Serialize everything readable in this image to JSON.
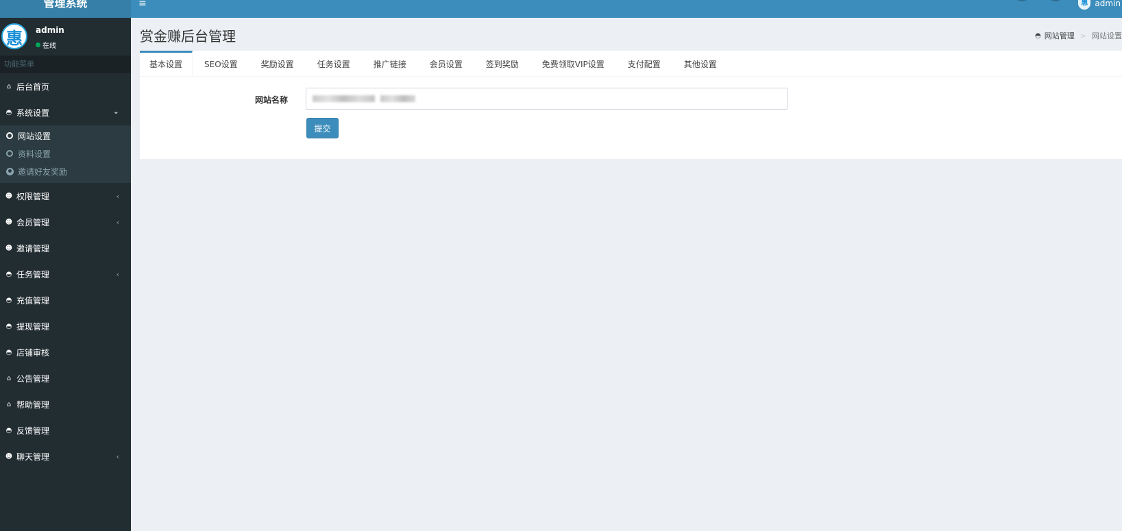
{
  "header": {
    "logo_text": "管理系统",
    "menu_toggle": "≡",
    "user_name": "admin",
    "avatar_char": "惠"
  },
  "sidebar": {
    "user": {
      "name": "admin",
      "status": "在线",
      "avatar_char": "惠"
    },
    "menu_header": "功能菜单",
    "items": [
      {
        "label": "后台首页",
        "icon": "home-icon"
      },
      {
        "label": "系统设置",
        "icon": "dashboard-icon",
        "expanded": true
      },
      {
        "label": "权限管理",
        "icon": "users-icon",
        "collapsible": true
      },
      {
        "label": "会员管理",
        "icon": "users-icon",
        "collapsible": true
      },
      {
        "label": "邀请管理",
        "icon": "users-icon"
      },
      {
        "label": "任务管理",
        "icon": "dashboard-icon",
        "collapsible": true
      },
      {
        "label": "充值管理",
        "icon": "dashboard-icon"
      },
      {
        "label": "提现管理",
        "icon": "dashboard-icon"
      },
      {
        "label": "店铺审核",
        "icon": "dashboard-icon"
      },
      {
        "label": "公告管理",
        "icon": "home-icon"
      },
      {
        "label": "帮助管理",
        "icon": "home-icon"
      },
      {
        "label": "反馈管理",
        "icon": "dashboard-icon"
      },
      {
        "label": "聊天管理",
        "icon": "users-icon",
        "collapsible": true
      }
    ],
    "submenu": [
      {
        "label": "网站设置",
        "active": true,
        "icon": "circle-icon"
      },
      {
        "label": "资料设置",
        "icon": "circle-icon"
      },
      {
        "label": "邀请好友奖励",
        "icon": "user-circle-icon"
      }
    ]
  },
  "content": {
    "title": "赏金赚后台管理",
    "breadcrumb": {
      "parent": "网站管理",
      "separator": ">",
      "current": "网站设置"
    },
    "tabs": [
      "基本设置",
      "SEO设置",
      "奖励设置",
      "任务设置",
      "推广链接",
      "会员设置",
      "签到奖励",
      "免费领取VIP设置",
      "支付配置",
      "其他设置"
    ],
    "active_tab": 0,
    "form": {
      "site_name_label": "网站名称",
      "site_name_value": "",
      "submit_label": "提交"
    }
  },
  "colors": {
    "header_bg": "#3c8dbc",
    "logo_bg": "#367fa9",
    "sidebar_bg": "#222d32",
    "submenu_bg": "#2c3b41",
    "content_bg": "#ecf0f5",
    "status_online": "#00a65a"
  }
}
